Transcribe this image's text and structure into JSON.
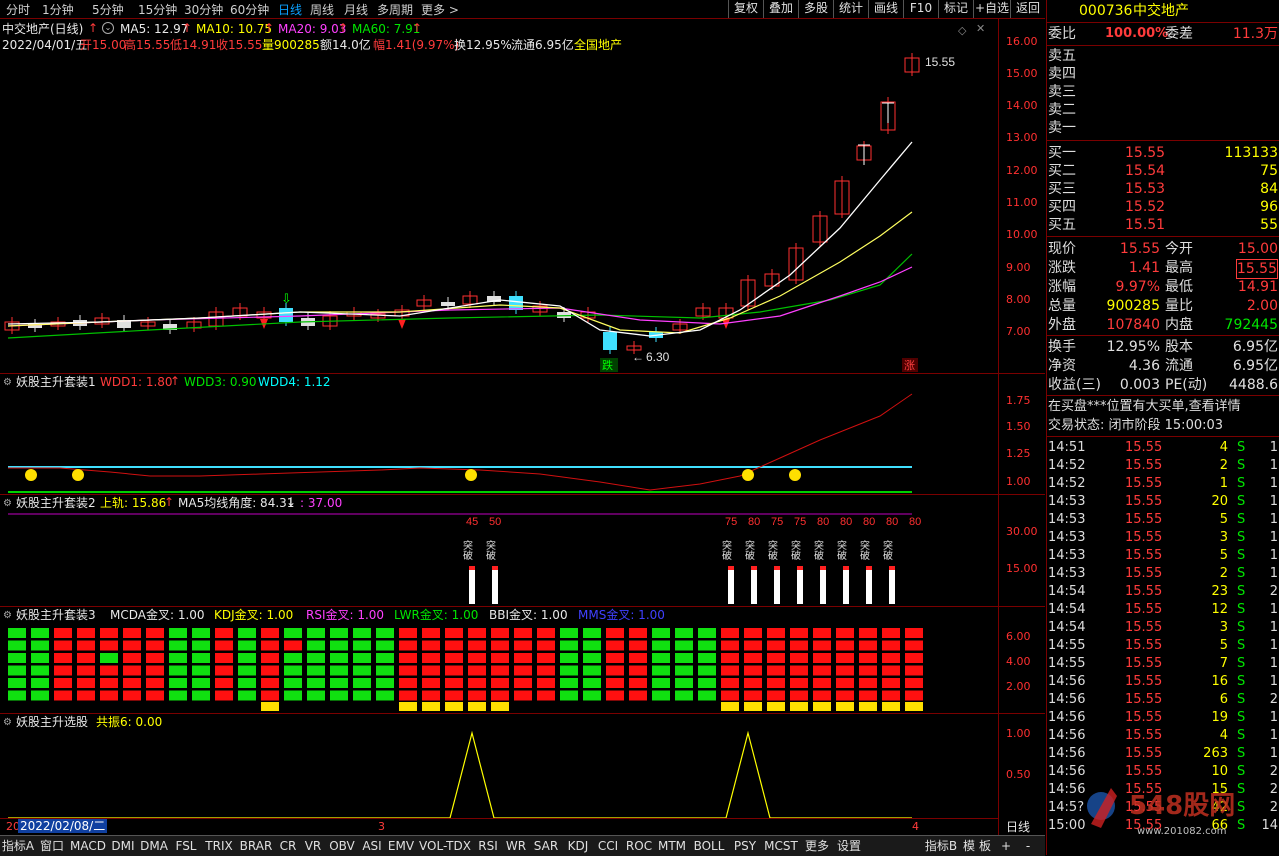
{
  "toolbar": {
    "periods": [
      "分时",
      "1分钟",
      "5分钟",
      "15分钟",
      "30分钟",
      "60分钟",
      "日线",
      "周线",
      "月线",
      "多周期",
      "更多 >"
    ],
    "active": "日线",
    "right_buttons": [
      "复权",
      "叠加",
      "多股",
      "统计",
      "画线",
      "F10",
      "标记",
      "+自选",
      "返回"
    ]
  },
  "chart_header": {
    "name": "中交地产(日线)",
    "ma5": "MA5: 12.97",
    "ma10": "MA10: 10.75",
    "ma20": "MA20: 9.03",
    "ma60": "MA60: 7.91",
    "date": "2022/04/01/五",
    "open": "开15.00",
    "high": "高15.55",
    "low": "低14.91",
    "close": "收15.55",
    "vol": "量900285",
    "amount": "额14.0亿",
    "change": "幅1.41(9.97%)",
    "turnover": "换12.95%",
    "float": "流通6.95亿",
    "sector": "全国地产"
  },
  "chart_labels": {
    "last_price": "15.55",
    "low_mark": "6.30",
    "fall_tag": "跌",
    "rise_tag": "涨"
  },
  "price_axis": [
    "16.00",
    "15.00",
    "14.00",
    "13.00",
    "12.00",
    "11.00",
    "10.00",
    "9.00",
    "8.00",
    "7.00"
  ],
  "panel1": {
    "title": "妖股主升套装1",
    "wdd1": "WDD1: 1.80",
    "wdd3": "WDD3: 0.90",
    "wdd4": "WDD4: 1.12",
    "axis": [
      "1.75",
      "1.50",
      "1.25",
      "1.00"
    ]
  },
  "panel2": {
    "title": "妖股主升套装2",
    "upper": "上轨: 15.86",
    "angle": "MA5均线角度: 84.31",
    "angle2": ": 37.00",
    "axis": [
      "30.00",
      "15.00"
    ],
    "signal_label": "突破",
    "signals": [
      "45",
      "50",
      "75",
      "80",
      "75",
      "75",
      "80",
      "80",
      "80",
      "80",
      "80"
    ]
  },
  "panel3": {
    "title": "妖股主升套装3",
    "mcda": "MCDA金叉: 1.00",
    "kdj": "KDJ金叉: 1.00",
    "rsi": "RSI金叉: 1.00",
    "lwr": "LWR金叉: 1.00",
    "bbi": "BBI金叉: 1.00",
    "mms": "MMS金叉: 1.00",
    "axis": [
      "6.00",
      "4.00",
      "2.00"
    ]
  },
  "panel4": {
    "title": "妖股主升选股",
    "value": "共振6: 0.00",
    "axis": [
      "1.00",
      "0.50"
    ]
  },
  "xaxis": {
    "start_marker": "20",
    "date": "2022/02/08/二",
    "m3": "3",
    "m4": "4",
    "period": "日线"
  },
  "bottom_tabs": [
    "指标A",
    "窗口",
    "MACD",
    "DMI",
    "DMA",
    "FSL",
    "TRIX",
    "BRAR",
    "CR",
    "VR",
    "OBV",
    "ASI",
    "EMV",
    "VOL-TDX",
    "RSI",
    "WR",
    "SAR",
    "KDJ",
    "CCI",
    "ROC",
    "MTM",
    "BOLL",
    "PSY",
    "MCST",
    "更多",
    "设置"
  ],
  "bottom_right": [
    "指标B",
    "模",
    "板",
    "+",
    "-"
  ],
  "quote": {
    "code": "000736",
    "name": "中交地产",
    "ratio_label": "委比",
    "ratio": "100.00%",
    "diff_label": "委差",
    "diff": "11.3万",
    "sells": [
      "卖五",
      "卖四",
      "卖三",
      "卖二",
      "卖一"
    ],
    "buys": [
      {
        "label": "买一",
        "price": "15.55",
        "vol": "113133"
      },
      {
        "label": "买二",
        "price": "15.54",
        "vol": "75"
      },
      {
        "label": "买三",
        "price": "15.53",
        "vol": "84"
      },
      {
        "label": "买四",
        "price": "15.52",
        "vol": "96"
      },
      {
        "label": "买五",
        "price": "15.51",
        "vol": "55"
      }
    ],
    "stats": [
      {
        "l1": "现价",
        "v1": "15.55",
        "l2": "今开",
        "v2": "15.00"
      },
      {
        "l1": "涨跌",
        "v1": "1.41",
        "l2": "最高",
        "v2": "15.55"
      },
      {
        "l1": "涨幅",
        "v1": "9.97%",
        "l2": "最低",
        "v2": "14.91"
      },
      {
        "l1": "总量",
        "v1": "900285",
        "l2": "量比",
        "v2": "2.00"
      },
      {
        "l1": "外盘",
        "v1": "107840",
        "l2": "内盘",
        "v2": "792445"
      }
    ],
    "stats2": [
      {
        "l1": "换手",
        "v1": "12.95%",
        "l2": "股本",
        "v2": "6.95亿"
      },
      {
        "l1": "净资",
        "v1": "4.36",
        "l2": "流通",
        "v2": "6.95亿"
      },
      {
        "l1": "收益(三)",
        "v1": "0.003",
        "l2": "PE(动)",
        "v2": "4488.6"
      }
    ],
    "notice": "在买盘***位置有大买单,查看详情",
    "status": "交易状态: 闭市阶段 15:00:03",
    "ticks": [
      {
        "t": "14:51",
        "p": "15.55",
        "v": "4",
        "s": "S",
        "n": "1"
      },
      {
        "t": "14:52",
        "p": "15.55",
        "v": "2",
        "s": "S",
        "n": "1"
      },
      {
        "t": "14:52",
        "p": "15.55",
        "v": "1",
        "s": "S",
        "n": "1"
      },
      {
        "t": "14:53",
        "p": "15.55",
        "v": "20",
        "s": "S",
        "n": "1"
      },
      {
        "t": "14:53",
        "p": "15.55",
        "v": "5",
        "s": "S",
        "n": "1"
      },
      {
        "t": "14:53",
        "p": "15.55",
        "v": "3",
        "s": "S",
        "n": "1"
      },
      {
        "t": "14:53",
        "p": "15.55",
        "v": "5",
        "s": "S",
        "n": "1"
      },
      {
        "t": "14:53",
        "p": "15.55",
        "v": "2",
        "s": "S",
        "n": "1"
      },
      {
        "t": "14:54",
        "p": "15.55",
        "v": "23",
        "s": "S",
        "n": "2"
      },
      {
        "t": "14:54",
        "p": "15.55",
        "v": "12",
        "s": "S",
        "n": "1"
      },
      {
        "t": "14:54",
        "p": "15.55",
        "v": "3",
        "s": "S",
        "n": "1"
      },
      {
        "t": "14:55",
        "p": "15.55",
        "v": "5",
        "s": "S",
        "n": "1"
      },
      {
        "t": "14:55",
        "p": "15.55",
        "v": "7",
        "s": "S",
        "n": "1"
      },
      {
        "t": "14:56",
        "p": "15.55",
        "v": "16",
        "s": "S",
        "n": "1"
      },
      {
        "t": "14:56",
        "p": "15.55",
        "v": "6",
        "s": "S",
        "n": "2"
      },
      {
        "t": "14:56",
        "p": "15.55",
        "v": "19",
        "s": "S",
        "n": "1"
      },
      {
        "t": "14:56",
        "p": "15.55",
        "v": "4",
        "s": "S",
        "n": "1"
      },
      {
        "t": "14:56",
        "p": "15.55",
        "v": "263",
        "s": "S",
        "n": "1"
      },
      {
        "t": "14:56",
        "p": "15.55",
        "v": "10",
        "s": "S",
        "n": "2"
      },
      {
        "t": "14:56",
        "p": "15.55",
        "v": "15",
        "s": "S",
        "n": "2"
      },
      {
        "t": "14:5?",
        "p": "15.55",
        "v": "42",
        "s": "S",
        "n": "2"
      },
      {
        "t": "15:00",
        "p": "15.55",
        "v": "66",
        "s": "S",
        "n": "14"
      }
    ],
    "watermark": "548股网",
    "watermark_url": "www.201082.com"
  }
}
